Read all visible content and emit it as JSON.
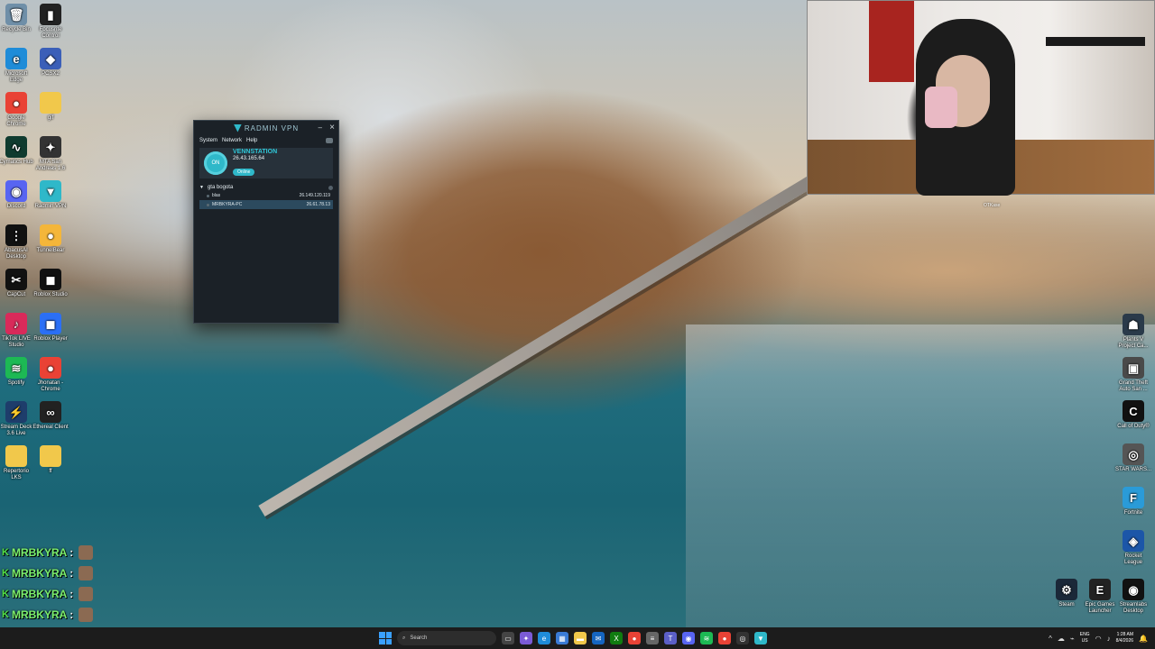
{
  "desktop": {
    "left_icons": [
      {
        "label": "Recycle Bin",
        "icon": "recycle-bin-icon",
        "color": "#6f8fa8",
        "glyph": "🗑"
      },
      {
        "label": "Focusrite Control",
        "icon": "focusrite-icon",
        "color": "#222222",
        "glyph": "▮"
      },
      {
        "label": "Microsoft Edge",
        "icon": "edge-icon",
        "color": "#1f8cd8",
        "glyph": "e"
      },
      {
        "label": "PCSX2",
        "icon": "pcsx2-icon",
        "color": "#3b5fb8",
        "glyph": "◆"
      },
      {
        "label": "Google Chrome",
        "icon": "chrome-icon",
        "color": "#e94235",
        "glyph": "●"
      },
      {
        "label": "gif",
        "icon": "folder-icon",
        "color": "#f1c84b",
        "glyph": ""
      },
      {
        "label": "Cymatics Hub",
        "icon": "cymatics-icon",
        "color": "#0f3b2f",
        "glyph": "∿"
      },
      {
        "label": "MTA San Andreas 1.6",
        "icon": "mta-icon",
        "color": "#333333",
        "glyph": "✦"
      },
      {
        "label": "Discord",
        "icon": "discord-icon",
        "color": "#5865f2",
        "glyph": "◉"
      },
      {
        "label": "Radmin VPN",
        "icon": "radmin-icon",
        "color": "#2fb8c9",
        "glyph": "▼"
      },
      {
        "label": "AbacusAI Desktop",
        "icon": "abacus-icon",
        "color": "#111111",
        "glyph": "⋮"
      },
      {
        "label": "TunnelBear",
        "icon": "tunnelbear-icon",
        "color": "#f4b63a",
        "glyph": "●"
      },
      {
        "label": "CapCut",
        "icon": "capcut-icon",
        "color": "#111111",
        "glyph": "✂"
      },
      {
        "label": "Roblox Studio",
        "icon": "roblox-studio-icon",
        "color": "#111111",
        "glyph": "◼"
      },
      {
        "label": "TikTok LIVE Studio",
        "icon": "tiktok-icon",
        "color": "#d92a5a",
        "glyph": "♪"
      },
      {
        "label": "Roblox Player",
        "icon": "roblox-player-icon",
        "color": "#2b6ff5",
        "glyph": "◼"
      },
      {
        "label": "Spotify",
        "icon": "spotify-icon",
        "color": "#1db954",
        "glyph": "≋"
      },
      {
        "label": "Jhonatan - Chrome",
        "icon": "chrome-profile-icon",
        "color": "#e94235",
        "glyph": "●"
      },
      {
        "label": "Stream Deck 3.6 Live",
        "icon": "streamdeck-icon",
        "color": "#1e3d6b",
        "glyph": "⚡"
      },
      {
        "label": "Ethereal Client",
        "icon": "ethereal-icon",
        "color": "#222222",
        "glyph": "∞"
      },
      {
        "label": "Repertorio LKS",
        "icon": "folder-icon",
        "color": "#f1c84b",
        "glyph": ""
      },
      {
        "label": "ff",
        "icon": "folder-icon",
        "color": "#f1c84b",
        "glyph": ""
      }
    ],
    "right_icons": [
      {
        "label": "Plants V Project Ca...",
        "icon": "game-icon",
        "color": "#2a3a4a",
        "glyph": "☗"
      },
      {
        "label": "Grand Theft Auto San ...",
        "icon": "gta-icon",
        "color": "#4a4a4a",
        "glyph": "▣"
      },
      {
        "label": "Call of Duty®",
        "icon": "cod-icon",
        "color": "#111111",
        "glyph": "C"
      },
      {
        "label": "STAR WARS...",
        "icon": "starwars-icon",
        "color": "#555555",
        "glyph": "◎"
      },
      {
        "label": "Fortnite",
        "icon": "fortnite-icon",
        "color": "#2a9bd8",
        "glyph": "F"
      },
      {
        "label": "Rocket League",
        "icon": "rocketleague-icon",
        "color": "#1c56a8",
        "glyph": "◈"
      }
    ],
    "bottom_icons": [
      {
        "label": "Steam",
        "icon": "steam-icon",
        "color": "#1b2838",
        "glyph": "⚙"
      },
      {
        "label": "Epic Games Launcher",
        "icon": "epic-icon",
        "color": "#222222",
        "glyph": "E"
      },
      {
        "label": "Streamlabs Desktop",
        "icon": "streamlabs-icon",
        "color": "#111111",
        "glyph": "◉"
      }
    ]
  },
  "radmin": {
    "title": "RADMIN VPN",
    "menu": [
      "System",
      "Network",
      "Help"
    ],
    "power_label": "ON",
    "hostname": "VENNSTATION",
    "ip": "26.43.165.64",
    "status": "Online",
    "network": {
      "name": "gta bogota",
      "peers": [
        {
          "name": "blas",
          "ip": "26.149.120.119"
        },
        {
          "name": "MRBKYRA-PC",
          "ip": "26.61.78.13"
        }
      ]
    }
  },
  "webcam": {
    "label": "OTKase"
  },
  "chat": {
    "lines": [
      {
        "user": "MRBKYRA",
        "sep": ":"
      },
      {
        "user": "MRBKYRA",
        "sep": ":"
      },
      {
        "user": "MRBKYRA",
        "sep": ":"
      },
      {
        "user": "MRBKYRA",
        "sep": ":"
      },
      {
        "user": "MRBKYRA",
        "sep": ":"
      }
    ]
  },
  "taskbar": {
    "search_placeholder": "Search",
    "apps": [
      {
        "icon": "task-view-icon",
        "color": "#444444",
        "glyph": "▭"
      },
      {
        "icon": "copilot-icon",
        "color": "#7b5bd6",
        "glyph": "✦"
      },
      {
        "icon": "edge-icon",
        "color": "#1f8cd8",
        "glyph": "e"
      },
      {
        "icon": "store-icon",
        "color": "#3a7bd5",
        "glyph": "▦"
      },
      {
        "icon": "file-explorer-icon",
        "color": "#f1c84b",
        "glyph": "▬"
      },
      {
        "icon": "mail-icon",
        "color": "#1565c0",
        "glyph": "✉"
      },
      {
        "icon": "xbox-icon",
        "color": "#107c10",
        "glyph": "X"
      },
      {
        "icon": "chrome-icon",
        "color": "#e94235",
        "glyph": "●"
      },
      {
        "icon": "notepad-icon",
        "color": "#666666",
        "glyph": "≡"
      },
      {
        "icon": "teams-icon",
        "color": "#5b5fc7",
        "glyph": "T"
      },
      {
        "icon": "discord-icon",
        "color": "#5865f2",
        "glyph": "◉"
      },
      {
        "icon": "spotify-icon",
        "color": "#1db954",
        "glyph": "≋"
      },
      {
        "icon": "chrome-profile-icon",
        "color": "#e94235",
        "glyph": "●"
      },
      {
        "icon": "obs-icon",
        "color": "#333333",
        "glyph": "◎"
      },
      {
        "icon": "radmin-icon",
        "color": "#2fb8c9",
        "glyph": "▼"
      }
    ],
    "lang_top": "ENG",
    "lang_bottom": "US",
    "time": "1:28 AM",
    "date": "8/4/2026"
  }
}
